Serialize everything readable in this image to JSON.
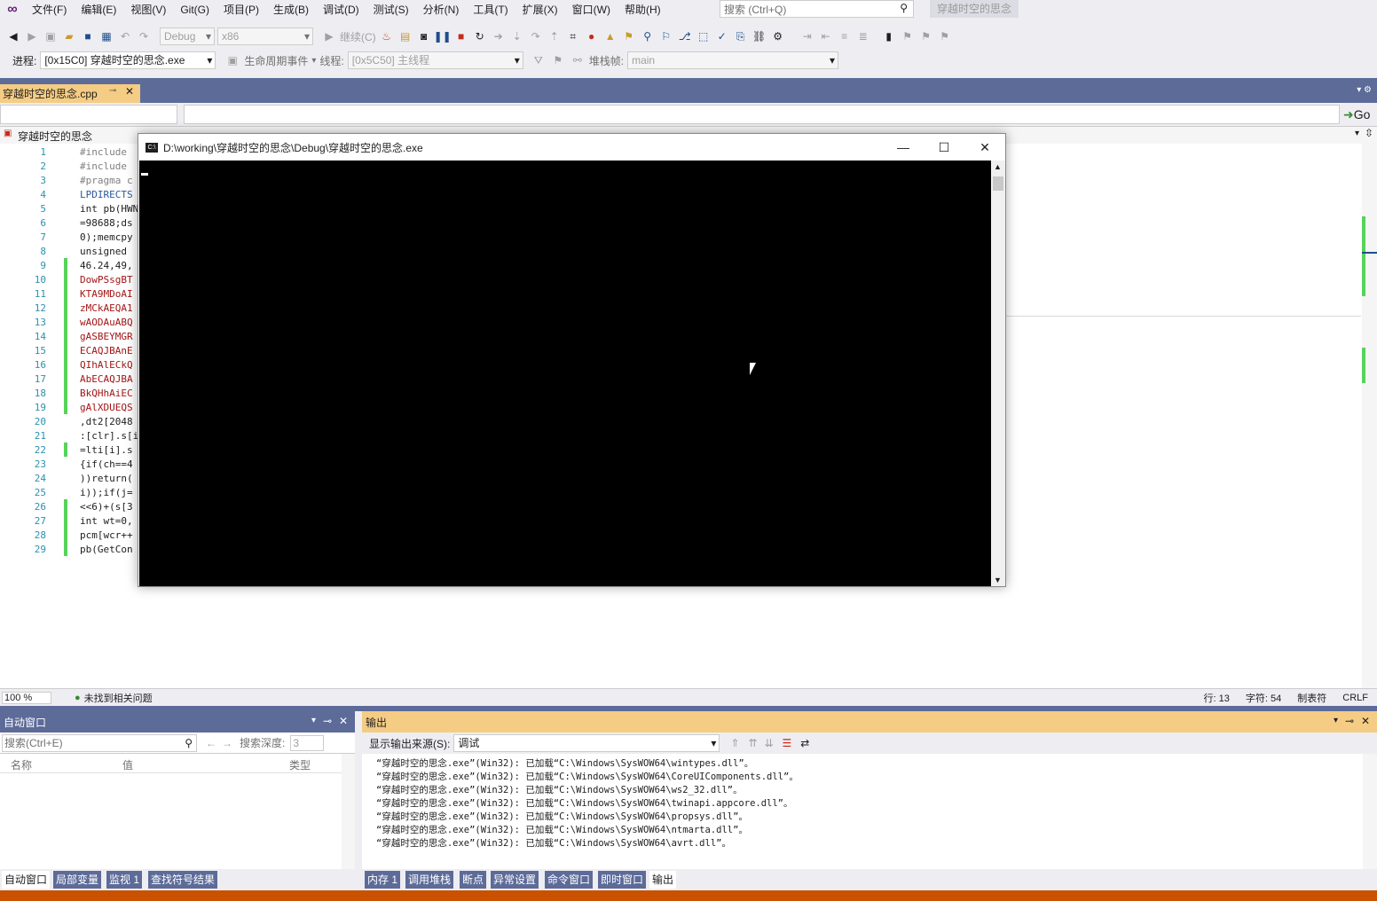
{
  "menubar": {
    "items": [
      "文件(F)",
      "编辑(E)",
      "视图(V)",
      "Git(G)",
      "项目(P)",
      "生成(B)",
      "调试(D)",
      "测试(S)",
      "分析(N)",
      "工具(T)",
      "扩展(X)",
      "窗口(W)",
      "帮助(H)"
    ],
    "search_placeholder": "搜索 (Ctrl+Q)",
    "solution_name": "穿越时空的思念"
  },
  "toolbar1": {
    "config": "Debug",
    "platform": "x86",
    "continue_label": "继续(C)"
  },
  "toolbar2": {
    "process_label": "进程:",
    "process_value": "[0x15C0] 穿越时空的思念.exe",
    "lifecycle_label": "生命周期事件",
    "thread_label": "线程:",
    "thread_value": "[0x5C50] 主线程",
    "stackframe_label": "堆栈帧:",
    "stackframe_value": "main"
  },
  "editor_tab": {
    "filename": "穿越时空的思念.cpp"
  },
  "navbar": {
    "go_label": "Go"
  },
  "scopebar": {
    "project": "穿越时空的思念"
  },
  "editor": {
    "lines": [
      "#include",
      "#include",
      "#pragma c",
      "LPDIRECTS",
      "int pb(HWN",
      "=98688;ds",
      "0);memcpy",
      "unsigned",
      "46.24,49,",
      "DowPSsgBT",
      "KTA9MDoAI",
      "zMCkAEQA1",
      "wAODAuABQ",
      "gASBEYMGR",
      "ECAQJBAnE",
      "QIhAlECkQ",
      "AbECAQJBA",
      "BkQHhAiEC",
      "gAlXDUEQS",
      ",dt2[2048",
      ":[clr].s[i",
      "=lti[i].s",
      "{if(ch==4",
      "))return(",
      "i));if(j=",
      "<<6)+(s[3",
      "int wt=0,",
      "pcm[wcr++",
      "pb(GetCon"
    ]
  },
  "statusbar": {
    "zoom": "100 %",
    "issues": "未找到相关问题",
    "line": "行: 13",
    "char": "字符: 54",
    "tab": "制表符",
    "eol": "CRLF"
  },
  "autowin": {
    "title": "自动窗口",
    "search_placeholder": "搜索(Ctrl+E)",
    "depth_label": "搜索深度:",
    "depth_value": "3",
    "col_name": "名称",
    "col_value": "值",
    "col_type": "类型"
  },
  "outwin": {
    "title": "输出",
    "source_label": "显示输出来源(S):",
    "source_value": "调试",
    "lines": [
      "“穿越时空的思念.exe”(Win32): 已加载“C:\\Windows\\SysWOW64\\wintypes.dll”。",
      "“穿越时空的思念.exe”(Win32): 已加载“C:\\Windows\\SysWOW64\\CoreUIComponents.dll”。",
      "“穿越时空的思念.exe”(Win32): 已加载“C:\\Windows\\SysWOW64\\ws2_32.dll”。",
      "“穿越时空的思念.exe”(Win32): 已加载“C:\\Windows\\SysWOW64\\twinapi.appcore.dll”。",
      "“穿越时空的思念.exe”(Win32): 已加载“C:\\Windows\\SysWOW64\\propsys.dll”。",
      "“穿越时空的思念.exe”(Win32): 已加载“C:\\Windows\\SysWOW64\\ntmarta.dll”。",
      "“穿越时空的思念.exe”(Win32): 已加载“C:\\Windows\\SysWOW64\\avrt.dll”。"
    ]
  },
  "bottomtabs": {
    "left": [
      "自动窗口",
      "局部变量",
      "监视 1",
      "查找符号结果"
    ],
    "right": [
      "内存 1",
      "调用堆栈",
      "断点",
      "异常设置",
      "命令窗口",
      "即时窗口",
      "输出"
    ]
  },
  "console": {
    "title": "D:\\working\\穿越时空的思念\\Debug\\穿越时空的思念.exe"
  },
  "colors": {
    "accent_blue": "#5d6b99",
    "tab_gold": "#f5cc84",
    "gutter_green": "#57d35a",
    "line_number": "#2b91af"
  }
}
